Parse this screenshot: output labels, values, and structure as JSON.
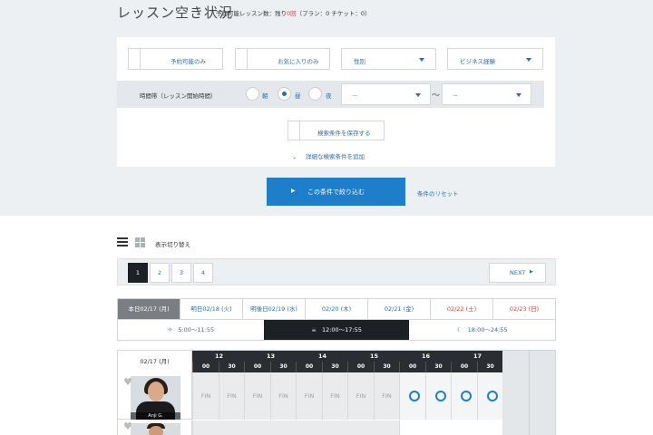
{
  "header": {
    "title": "レッスン空き状況",
    "remaining_prefix": "予約可能レッスン数：残り",
    "remaining_count": "0回",
    "remaining_suffix": "（プラン：0 チケット：0）"
  },
  "filters": {
    "available_only": "予約可能のみ",
    "favorites_only": "お気に入りのみ",
    "gender": "性別",
    "business": "ビジネス経験",
    "time_label": "時間帯（レッスン開始時間）",
    "morning": "朝",
    "noon": "昼",
    "night": "夜",
    "time_from": "--",
    "time_to": "--",
    "tilde": "〜",
    "save": "検索条件を保存する",
    "detail": "詳細な検索条件を追加",
    "search": "この条件で絞り込む",
    "reset": "条件のリセット"
  },
  "view": {
    "toggle": "表示切り替え"
  },
  "pager": {
    "pages": [
      "1",
      "2",
      "3",
      "4"
    ],
    "next": "NEXT"
  },
  "days": [
    "本日02/17 (月)",
    "明日02/18 (火)",
    "明後日02/19 (水)",
    "02/20 (木)",
    "02/21 (金)",
    "02/22 (土)",
    "02/23 (日)"
  ],
  "slots": [
    "5:00〜11:55",
    "12:00〜17:55",
    "18:00〜24:55"
  ],
  "schedule": {
    "date": "02/17 (月)",
    "hours": [
      "12",
      "13",
      "14",
      "15",
      "16",
      "17"
    ],
    "mins": [
      "00",
      "30"
    ],
    "fin": "FIN",
    "teacher_name": "Anji G."
  },
  "colors": {
    "accent": "#1f7ec9",
    "dark": "#1d2025",
    "weekend": "#d63c3c"
  }
}
